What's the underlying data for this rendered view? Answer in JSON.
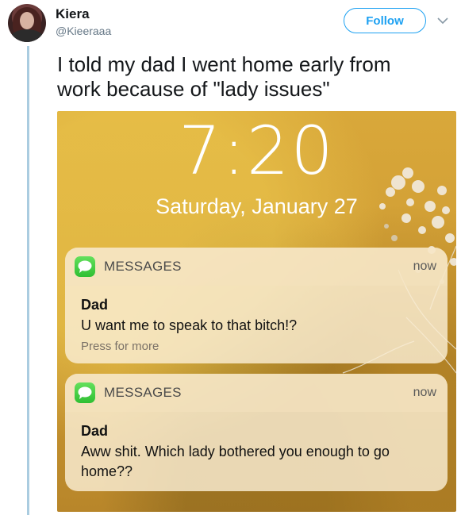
{
  "tweet": {
    "author_name": "Kiera",
    "author_handle": "@Kieeraaa",
    "follow_label": "Follow",
    "text": "I told my dad I went home early from work because of \"lady issues\""
  },
  "lockscreen": {
    "time": "7:20",
    "date": "Saturday, January 27",
    "notifications": [
      {
        "app": "MESSAGES",
        "time": "now",
        "sender": "Dad",
        "message": "U want me to speak to that bitch!?",
        "hint": "Press for more"
      },
      {
        "app": "MESSAGES",
        "time": "now",
        "sender": "Dad",
        "message": "Aww shit. Which lady bothered you enough to go home??"
      }
    ]
  },
  "colors": {
    "accent": "#1da1f2",
    "thread_line": "#aacce0",
    "messages_icon": "#34c638"
  },
  "icons": {
    "caret": "chevron-down-icon",
    "app": "messages-icon"
  }
}
